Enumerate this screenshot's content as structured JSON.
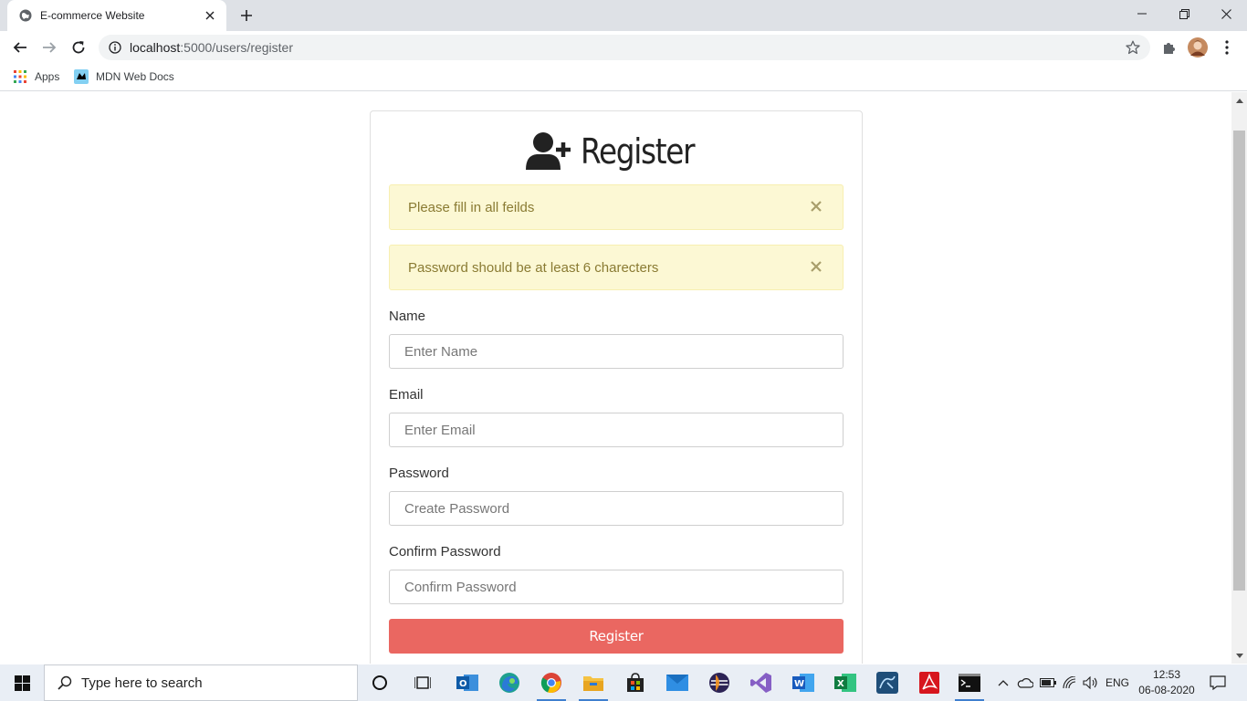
{
  "browser": {
    "tab_title": "E-commerce Website",
    "url_host": "localhost",
    "url_path": ":5000/users/register",
    "bookmarks": [
      {
        "label": "Apps"
      },
      {
        "label": "MDN Web Docs"
      }
    ]
  },
  "form": {
    "heading": "Register",
    "alerts": [
      {
        "message": "Please fill in all feilds"
      },
      {
        "message": "Password should be at least 6 charecters"
      }
    ],
    "fields": [
      {
        "label": "Name",
        "placeholder": "Enter Name"
      },
      {
        "label": "Email",
        "placeholder": "Enter Email"
      },
      {
        "label": "Password",
        "placeholder": "Create Password"
      },
      {
        "label": "Confirm Password",
        "placeholder": "Confirm Password"
      }
    ],
    "submit_label": "Register",
    "accent": "#ea6761",
    "alert_bg": "#fcf8d4"
  },
  "taskbar": {
    "search_placeholder": "Type here to search",
    "lang": "ENG",
    "time": "12:53",
    "date": "06-08-2020"
  }
}
